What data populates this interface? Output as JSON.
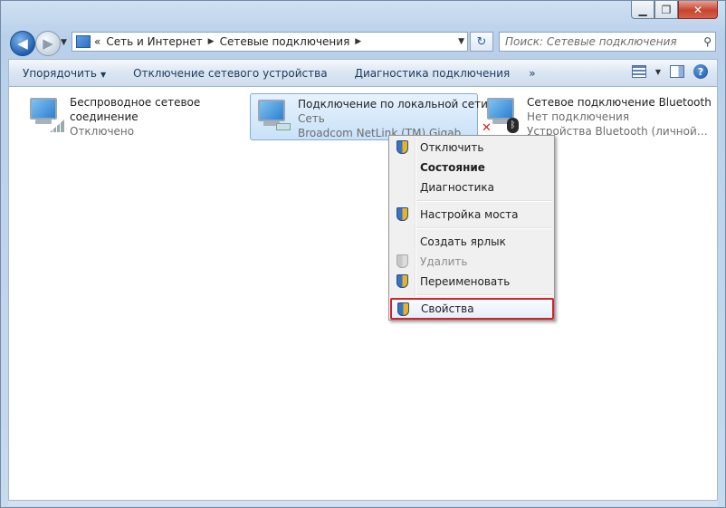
{
  "window": {
    "minimize": "▁",
    "maximize": "❐",
    "close": "✕"
  },
  "nav": {
    "back": "◀",
    "forward": "▶",
    "history_dropdown": "▼",
    "breadcrumb_overflow": "«",
    "breadcrumb": [
      "Сеть и Интернет",
      "Сетевые подключения"
    ],
    "address_dropdown": "▼",
    "refresh": "↻",
    "search_placeholder": "Поиск: Сетевые подключения"
  },
  "toolbar": {
    "organize": "Упорядочить",
    "disconnect": "Отключение сетевого устройства",
    "diagnose": "Диагностика подключения",
    "more": "»",
    "view_dropdown": "▼",
    "help": "?"
  },
  "connections": [
    {
      "name_line1": "Беспроводное сетевое",
      "name_line2": "соединение",
      "status": "Отключено",
      "device": "",
      "icon": "wireless-network-icon"
    },
    {
      "name_line1": "Подключение по локальной сети",
      "status": "Сеть",
      "device": "Broadcom NetLink (TM) Gigabit E...",
      "icon": "lan-network-icon",
      "selected": true
    },
    {
      "name_line1": "Сетевое подключение Bluetooth",
      "status": "Нет подключения",
      "device": "Устройства Bluetooth (личной с...",
      "icon": "bluetooth-network-icon"
    }
  ],
  "context_menu": {
    "disable": "Отключить",
    "status": "Состояние",
    "diagnose": "Диагностика",
    "bridge": "Настройка моста",
    "shortcut": "Создать ярлык",
    "delete": "Удалить",
    "rename": "Переименовать",
    "properties": "Свойства"
  },
  "colors": {
    "highlight_border": "#d2232a",
    "selection": "#c9e1f8"
  }
}
